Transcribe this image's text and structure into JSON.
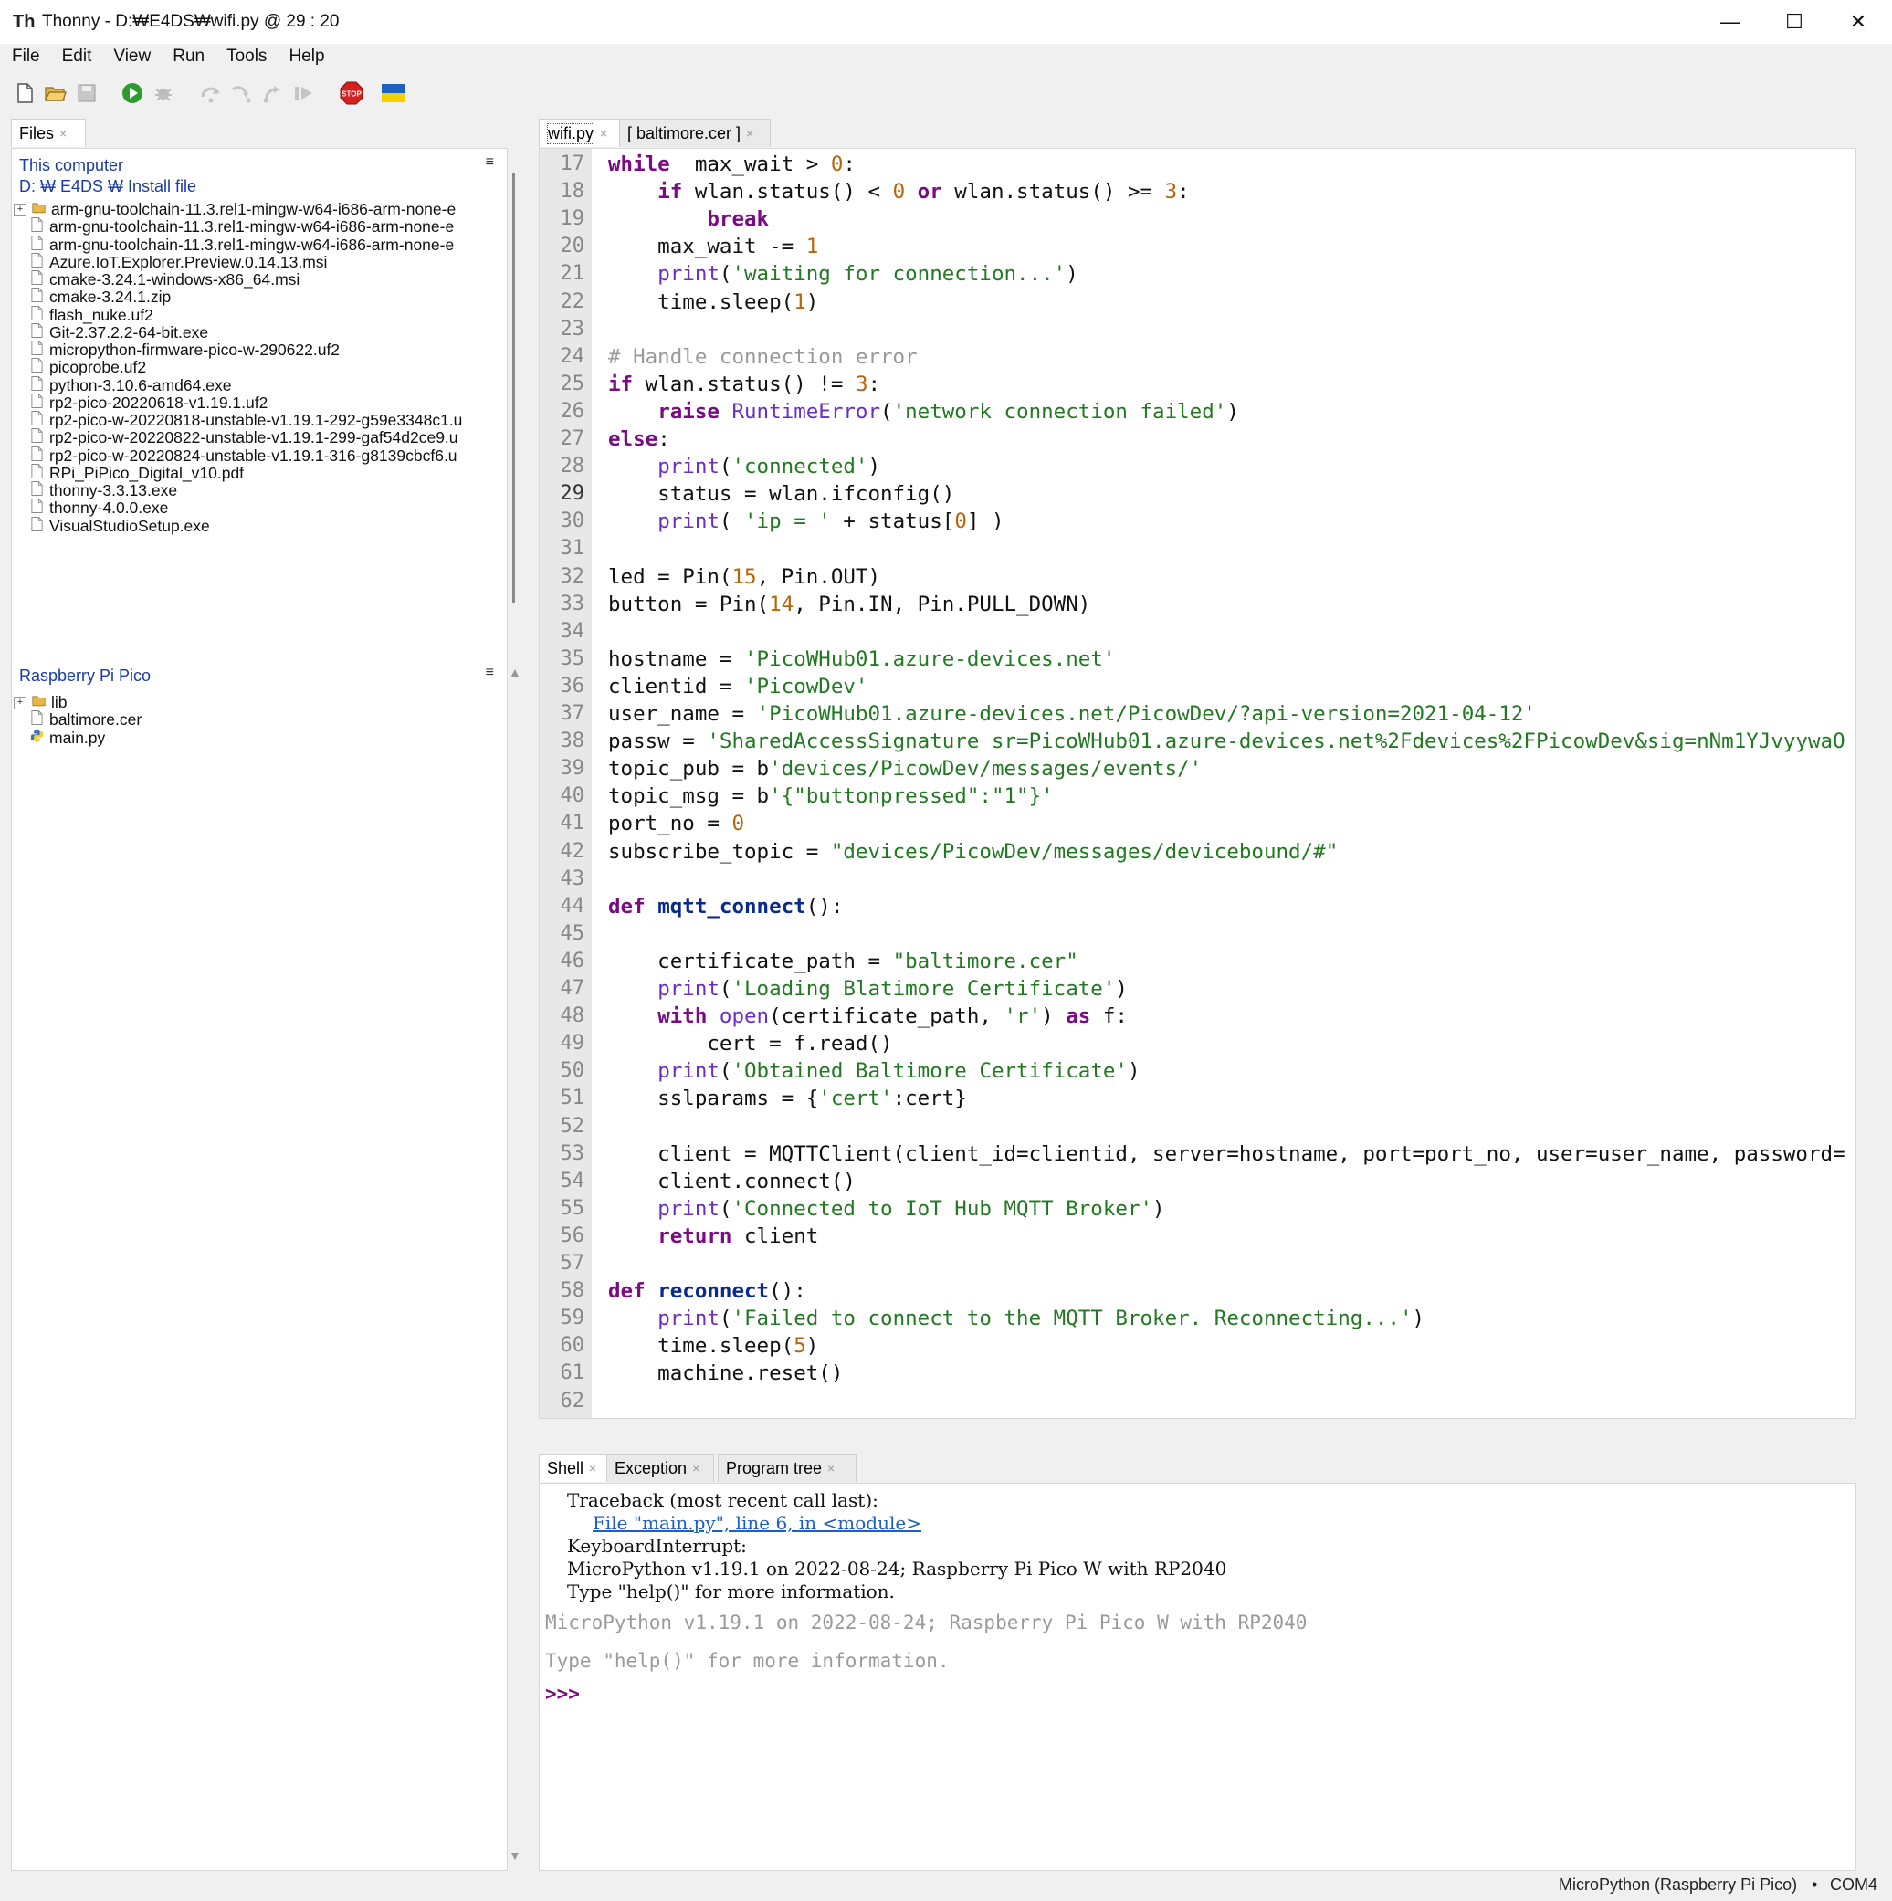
{
  "window": {
    "app_name": "Thonny",
    "title": "Thonny  -  D:₩E4DS₩wifi.py  @  29 : 20",
    "minimize": "—",
    "maximize": "☐",
    "close": "✕"
  },
  "menu": [
    "File",
    "Edit",
    "View",
    "Run",
    "Tools",
    "Help"
  ],
  "toolbar": {
    "icons": [
      "new-file-icon",
      "open-folder-icon",
      "save-icon",
      "run-icon",
      "debug-icon",
      "step-over-icon",
      "step-into-icon",
      "step-out-icon",
      "resume-icon",
      "stop-icon",
      "ukraine-flag-icon"
    ],
    "stop_label": "STOP",
    "colors": {
      "run": "#2e9b2e",
      "stop": "#d52020",
      "flag_blue": "#1f5fbf",
      "flag_yellow": "#f5d000"
    }
  },
  "files_panel": {
    "tab_label": "Files",
    "computer_section": {
      "title": "This computer",
      "path": "D: ₩ E4DS ₩ Install file",
      "items": [
        {
          "name": "arm-gnu-toolchain-11.3.rel1-mingw-w64-i686-arm-none-e",
          "type": "folder"
        },
        {
          "name": "arm-gnu-toolchain-11.3.rel1-mingw-w64-i686-arm-none-e",
          "type": "file"
        },
        {
          "name": "arm-gnu-toolchain-11.3.rel1-mingw-w64-i686-arm-none-e",
          "type": "file"
        },
        {
          "name": "Azure.IoT.Explorer.Preview.0.14.13.msi",
          "type": "file"
        },
        {
          "name": "cmake-3.24.1-windows-x86_64.msi",
          "type": "file"
        },
        {
          "name": "cmake-3.24.1.zip",
          "type": "file"
        },
        {
          "name": "flash_nuke.uf2",
          "type": "file"
        },
        {
          "name": "Git-2.37.2.2-64-bit.exe",
          "type": "file"
        },
        {
          "name": "micropython-firmware-pico-w-290622.uf2",
          "type": "file"
        },
        {
          "name": "picoprobe.uf2",
          "type": "file"
        },
        {
          "name": "python-3.10.6-amd64.exe",
          "type": "file"
        },
        {
          "name": "rp2-pico-20220618-v1.19.1.uf2",
          "type": "file"
        },
        {
          "name": "rp2-pico-w-20220818-unstable-v1.19.1-292-g59e3348c1.u",
          "type": "file"
        },
        {
          "name": "rp2-pico-w-20220822-unstable-v1.19.1-299-gaf54d2ce9.u",
          "type": "file"
        },
        {
          "name": "rp2-pico-w-20220824-unstable-v1.19.1-316-g8139cbcf6.u",
          "type": "file"
        },
        {
          "name": "RPi_PiPico_Digital_v10.pdf",
          "type": "file"
        },
        {
          "name": "thonny-3.3.13.exe",
          "type": "file"
        },
        {
          "name": "thonny-4.0.0.exe",
          "type": "file"
        },
        {
          "name": "VisualStudioSetup.exe",
          "type": "file"
        }
      ]
    },
    "device_section": {
      "title": "Raspberry Pi Pico",
      "items": [
        {
          "name": "lib",
          "type": "folder"
        },
        {
          "name": "baltimore.cer",
          "type": "file"
        },
        {
          "name": "main.py",
          "type": "python"
        }
      ]
    },
    "section_menu_glyph": "≡"
  },
  "editor": {
    "tabs": [
      {
        "label": "wifi.py",
        "active": true
      },
      {
        "label": "[ baltimore.cer ]",
        "active": false
      }
    ],
    "current_line": 29,
    "lines": [
      {
        "n": "17",
        "tokens": [
          [
            "kw",
            "while"
          ],
          [
            "",
            "  max_wait > "
          ],
          [
            "num",
            "0"
          ],
          [
            "",
            ":"
          ]
        ]
      },
      {
        "n": "18",
        "tokens": [
          [
            "",
            "    "
          ],
          [
            "kw",
            "if"
          ],
          [
            "",
            " wlan.status() < "
          ],
          [
            "num",
            "0"
          ],
          [
            "",
            " "
          ],
          [
            "kw",
            "or"
          ],
          [
            "",
            " wlan.status() >= "
          ],
          [
            "num",
            "3"
          ],
          [
            "",
            ":"
          ]
        ]
      },
      {
        "n": "19",
        "tokens": [
          [
            "",
            "        "
          ],
          [
            "kw",
            "break"
          ]
        ]
      },
      {
        "n": "20",
        "tokens": [
          [
            "",
            "    max_wait -= "
          ],
          [
            "num",
            "1"
          ]
        ]
      },
      {
        "n": "21",
        "tokens": [
          [
            "",
            "    "
          ],
          [
            "bi",
            "print"
          ],
          [
            "",
            "("
          ],
          [
            "str",
            "'waiting for connection...'"
          ],
          [
            "",
            ")"
          ]
        ]
      },
      {
        "n": "22",
        "tokens": [
          [
            "",
            "    time.sleep("
          ],
          [
            "num",
            "1"
          ],
          [
            "",
            ")"
          ]
        ]
      },
      {
        "n": "23",
        "tokens": []
      },
      {
        "n": "24",
        "tokens": [
          [
            "cm",
            "# Handle connection error"
          ]
        ]
      },
      {
        "n": "25",
        "tokens": [
          [
            "kw",
            "if"
          ],
          [
            "",
            " wlan.status() != "
          ],
          [
            "num",
            "3"
          ],
          [
            "",
            ":"
          ]
        ]
      },
      {
        "n": "26",
        "tokens": [
          [
            "",
            "    "
          ],
          [
            "kw",
            "raise"
          ],
          [
            "",
            " "
          ],
          [
            "bi",
            "RuntimeError"
          ],
          [
            "",
            "("
          ],
          [
            "str",
            "'network connection failed'"
          ],
          [
            "",
            ")"
          ]
        ]
      },
      {
        "n": "27",
        "tokens": [
          [
            "kw",
            "else"
          ],
          [
            "",
            ":"
          ]
        ]
      },
      {
        "n": "28",
        "tokens": [
          [
            "",
            "    "
          ],
          [
            "bi",
            "print"
          ],
          [
            "",
            "("
          ],
          [
            "str",
            "'connected'"
          ],
          [
            "",
            ")"
          ]
        ]
      },
      {
        "n": "29",
        "tokens": [
          [
            "",
            "    status = wlan.ifconfig()"
          ]
        ]
      },
      {
        "n": "30",
        "tokens": [
          [
            "",
            "    "
          ],
          [
            "bi",
            "print"
          ],
          [
            "",
            "( "
          ],
          [
            "str",
            "'ip = '"
          ],
          [
            "",
            " + status["
          ],
          [
            "num",
            "0"
          ],
          [
            "",
            "] )"
          ]
        ]
      },
      {
        "n": "31",
        "tokens": []
      },
      {
        "n": "32",
        "tokens": [
          [
            "",
            "led = Pin("
          ],
          [
            "num",
            "15"
          ],
          [
            "",
            ", Pin.OUT)"
          ]
        ]
      },
      {
        "n": "33",
        "tokens": [
          [
            "",
            "button = Pin("
          ],
          [
            "num",
            "14"
          ],
          [
            "",
            ", Pin.IN, Pin.PULL_DOWN)"
          ]
        ]
      },
      {
        "n": "34",
        "tokens": []
      },
      {
        "n": "35",
        "tokens": [
          [
            "",
            "hostname = "
          ],
          [
            "str",
            "'PicoWHub01.azure-devices.net'"
          ]
        ]
      },
      {
        "n": "36",
        "tokens": [
          [
            "",
            "clientid = "
          ],
          [
            "str",
            "'PicowDev'"
          ]
        ]
      },
      {
        "n": "37",
        "tokens": [
          [
            "",
            "user_name = "
          ],
          [
            "str",
            "'PicoWHub01.azure-devices.net/PicowDev/?api-version=2021-04-12'"
          ]
        ]
      },
      {
        "n": "38",
        "tokens": [
          [
            "",
            "passw = "
          ],
          [
            "str",
            "'SharedAccessSignature sr=PicoWHub01.azure-devices.net%2Fdevices%2FPicowDev&sig=nNm1YJvyywaO"
          ]
        ]
      },
      {
        "n": "39",
        "tokens": [
          [
            "",
            "topic_pub = b"
          ],
          [
            "str",
            "'devices/PicowDev/messages/events/'"
          ]
        ]
      },
      {
        "n": "40",
        "tokens": [
          [
            "",
            "topic_msg = b"
          ],
          [
            "str",
            "'{\"buttonpressed\":\"1\"}'"
          ]
        ]
      },
      {
        "n": "41",
        "tokens": [
          [
            "",
            "port_no = "
          ],
          [
            "num",
            "0"
          ]
        ]
      },
      {
        "n": "42",
        "tokens": [
          [
            "",
            "subscribe_topic = "
          ],
          [
            "str",
            "\"devices/PicowDev/messages/devicebound/#\""
          ]
        ]
      },
      {
        "n": "43",
        "tokens": []
      },
      {
        "n": "44",
        "tokens": [
          [
            "kw",
            "def"
          ],
          [
            "",
            " "
          ],
          [
            "fn",
            "mqtt_connect"
          ],
          [
            "",
            "():"
          ]
        ]
      },
      {
        "n": "45",
        "tokens": []
      },
      {
        "n": "46",
        "tokens": [
          [
            "",
            "    certificate_path = "
          ],
          [
            "str",
            "\"baltimore.cer\""
          ]
        ]
      },
      {
        "n": "47",
        "tokens": [
          [
            "",
            "    "
          ],
          [
            "bi",
            "print"
          ],
          [
            "",
            "("
          ],
          [
            "str",
            "'Loading Blatimore Certificate'"
          ],
          [
            "",
            ")"
          ]
        ]
      },
      {
        "n": "48",
        "tokens": [
          [
            "",
            "    "
          ],
          [
            "kw",
            "with"
          ],
          [
            "",
            " "
          ],
          [
            "bi",
            "open"
          ],
          [
            "",
            "(certificate_path, "
          ],
          [
            "str",
            "'r'"
          ],
          [
            "",
            ") "
          ],
          [
            "kw",
            "as"
          ],
          [
            "",
            " f:"
          ]
        ]
      },
      {
        "n": "49",
        "tokens": [
          [
            "",
            "        cert = f.read()"
          ]
        ]
      },
      {
        "n": "50",
        "tokens": [
          [
            "",
            "    "
          ],
          [
            "bi",
            "print"
          ],
          [
            "",
            "("
          ],
          [
            "str",
            "'Obtained Baltimore Certificate'"
          ],
          [
            "",
            ")"
          ]
        ]
      },
      {
        "n": "51",
        "tokens": [
          [
            "",
            "    sslparams = {"
          ],
          [
            "str",
            "'cert'"
          ],
          [
            "",
            ":cert}"
          ]
        ]
      },
      {
        "n": "52",
        "tokens": []
      },
      {
        "n": "53",
        "tokens": [
          [
            "",
            "    client = MQTTClient(client_id=clientid, server=hostname, port=port_no, user=user_name, password="
          ]
        ]
      },
      {
        "n": "54",
        "tokens": [
          [
            "",
            "    client.connect()"
          ]
        ]
      },
      {
        "n": "55",
        "tokens": [
          [
            "",
            "    "
          ],
          [
            "bi",
            "print"
          ],
          [
            "",
            "("
          ],
          [
            "str",
            "'Connected to IoT Hub MQTT Broker'"
          ],
          [
            "",
            ")"
          ]
        ]
      },
      {
        "n": "56",
        "tokens": [
          [
            "",
            "    "
          ],
          [
            "kw",
            "return"
          ],
          [
            "",
            " client"
          ]
        ]
      },
      {
        "n": "57",
        "tokens": []
      },
      {
        "n": "58",
        "tokens": [
          [
            "kw",
            "def"
          ],
          [
            "",
            " "
          ],
          [
            "fn",
            "reconnect"
          ],
          [
            "",
            "():"
          ]
        ]
      },
      {
        "n": "59",
        "tokens": [
          [
            "",
            "    "
          ],
          [
            "bi",
            "print"
          ],
          [
            "",
            "("
          ],
          [
            "str",
            "'Failed to connect to the MQTT Broker. Reconnecting...'"
          ],
          [
            "",
            ")"
          ]
        ]
      },
      {
        "n": "60",
        "tokens": [
          [
            "",
            "    time.sleep("
          ],
          [
            "num",
            "5"
          ],
          [
            "",
            ")"
          ]
        ]
      },
      {
        "n": "61",
        "tokens": [
          [
            "",
            "    machine.reset()"
          ]
        ]
      },
      {
        "n": "62",
        "tokens": []
      }
    ]
  },
  "bottom_panel": {
    "tabs": [
      {
        "label": "Shell",
        "active": true
      },
      {
        "label": "Exception",
        "active": false
      },
      {
        "label": "Program tree",
        "active": false
      }
    ],
    "shell_lines": [
      "Traceback (most recent call last):",
      "File \"main.py\", line 6, in <module>",
      "KeyboardInterrupt:",
      "MicroPython v1.19.1 on 2022-08-24; Raspberry Pi Pico W with RP2040",
      "Type \"help()\" for more information."
    ],
    "banner_lines": [
      "MicroPython v1.19.1 on 2022-08-24; Raspberry Pi Pico W with RP2040",
      "Type \"help()\" for more information."
    ],
    "prompt": ">>>"
  },
  "status": {
    "interpreter": "MicroPython (Raspberry Pi Pico)",
    "separator": "•",
    "port": "COM4"
  }
}
